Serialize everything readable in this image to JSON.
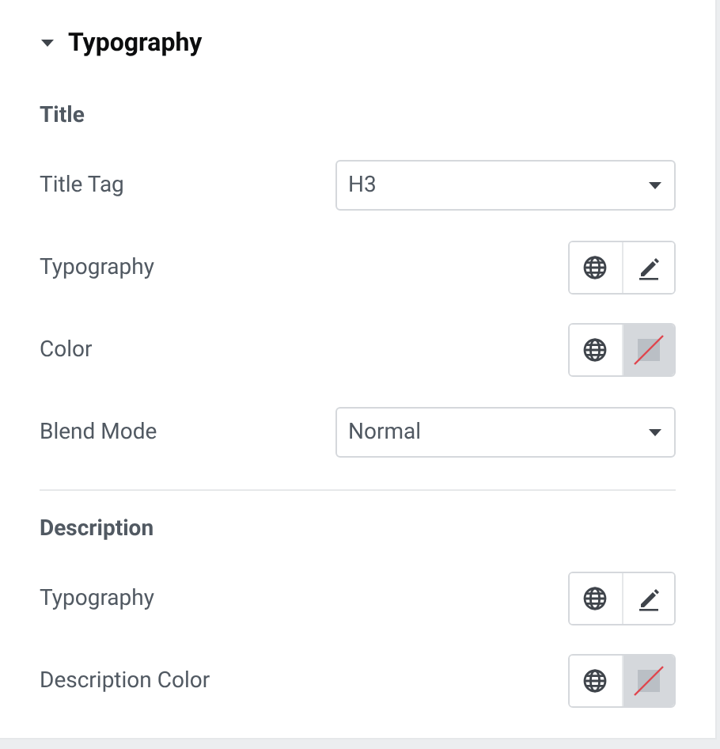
{
  "panel": {
    "title": "Typography",
    "expanded": true
  },
  "sections": [
    {
      "heading": "Title",
      "rows": [
        {
          "kind": "select",
          "label": "Title Tag",
          "value": "H3"
        },
        {
          "kind": "typography",
          "label": "Typography"
        },
        {
          "kind": "color",
          "label": "Color"
        },
        {
          "kind": "select",
          "label": "Blend Mode",
          "value": "Normal"
        }
      ]
    },
    {
      "heading": "Description",
      "rows": [
        {
          "kind": "typography",
          "label": "Typography"
        },
        {
          "kind": "color",
          "label": "Description Color"
        }
      ]
    }
  ]
}
